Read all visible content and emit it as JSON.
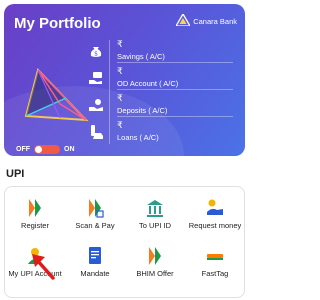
{
  "portfolio": {
    "title": "My Portfolio",
    "brand_name": "Canara Bank",
    "accounts": [
      {
        "icon": "money-bag-icon",
        "amount": "₹",
        "label": "Savings ( A/C)"
      },
      {
        "icon": "hand-money-icon",
        "amount": "₹",
        "label": "OD Account ( A/C)"
      },
      {
        "icon": "deposit-hand-icon",
        "amount": "₹",
        "label": "Deposits ( A/C)"
      },
      {
        "icon": "loan-icon",
        "amount": "₹",
        "label": "Loans ( A/C)"
      }
    ],
    "toggle": {
      "off_label": "OFF",
      "on_label": "ON",
      "state": "off"
    },
    "colors": {
      "card_start": "#6a3fc6",
      "card_end": "#4b72e6",
      "toggle": "#f15a45"
    }
  },
  "upi": {
    "heading": "UPI",
    "items": [
      {
        "label": "Register",
        "icon": "bhim-logo-icon"
      },
      {
        "label": "Scan & Pay",
        "icon": "scan-pay-icon"
      },
      {
        "label": "To UPI ID",
        "icon": "bank-icon"
      },
      {
        "label": "Request money",
        "icon": "request-money-icon"
      },
      {
        "label": "My UPI Account",
        "icon": "upi-account-icon"
      },
      {
        "label": "Mandate",
        "icon": "mandate-icon"
      },
      {
        "label": "BHIM Offer",
        "icon": "bhim-offer-icon"
      },
      {
        "label": "FastTag",
        "icon": "fasttag-icon"
      }
    ]
  }
}
